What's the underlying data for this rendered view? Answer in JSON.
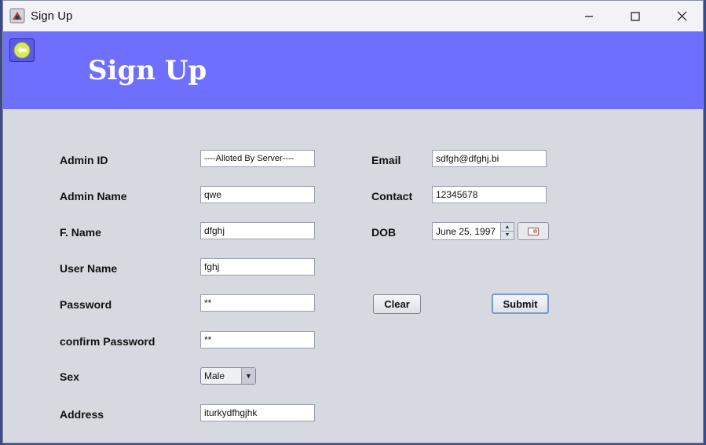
{
  "window": {
    "title": "Sign Up",
    "controls": [
      "minimize",
      "maximize",
      "close"
    ]
  },
  "header": {
    "title": "Sign Up",
    "back_icon": "back-arrow-icon"
  },
  "form": {
    "labels": {
      "admin_id": "Admin ID",
      "admin_name": "Admin Name",
      "f_name": "F. Name",
      "user_name": "User Name",
      "password": "Password",
      "confirm_password": "confirm Password",
      "sex": "Sex",
      "address": "Address",
      "email": "Email",
      "contact": "Contact",
      "dob": "DOB"
    },
    "values": {
      "admin_id": "----Alloted By Server----",
      "admin_name": "qwe",
      "f_name": "dfghj",
      "user_name": "fghj",
      "password": "**",
      "confirm_password": "**",
      "sex": "Male",
      "address": "iturkydfhgjhk",
      "email": "sdfgh@dfghj.bi",
      "contact": "12345678",
      "dob": "June 25, 1997"
    }
  },
  "buttons": {
    "clear": "Clear",
    "submit": "Submit"
  },
  "colors": {
    "header_bg": "#6e6eff",
    "panel_bg": "#d6d9e0",
    "back_button_accent": "#d8e85a"
  }
}
